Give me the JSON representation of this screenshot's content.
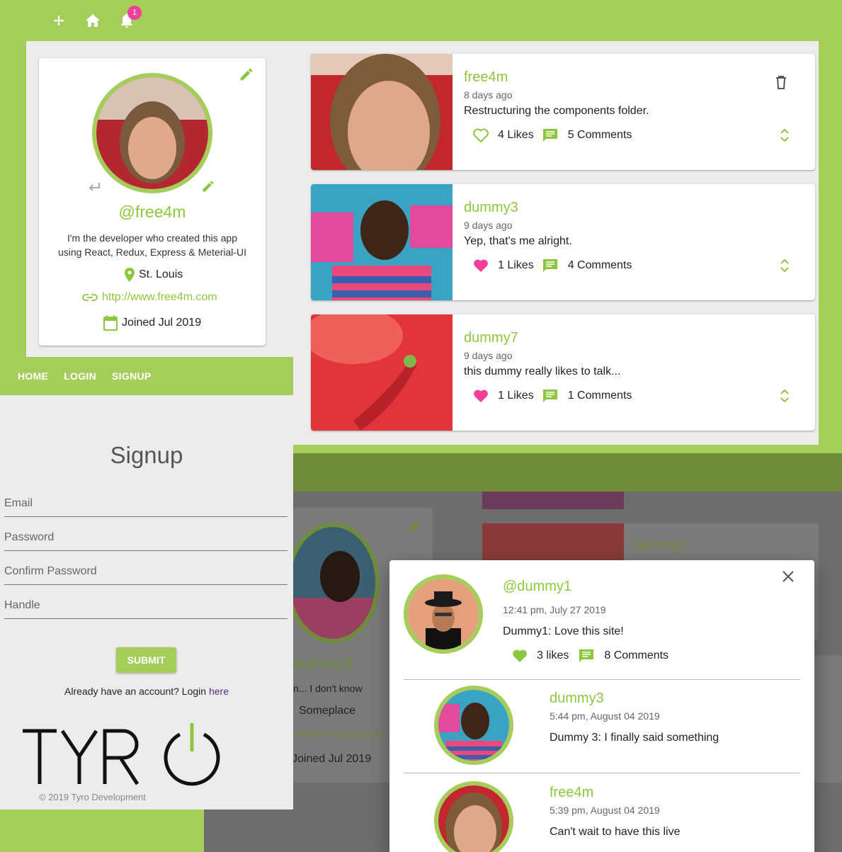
{
  "topbar": {
    "icons": [
      "add-icon",
      "home-icon",
      "notifications-icon"
    ],
    "notification_count": "1"
  },
  "profile": {
    "handle": "@free4m",
    "bio": "I'm the developer who created this app using React, Redux, Express & Meterial-UI",
    "location": "St. Louis",
    "website": "http://www.free4m.com",
    "joined": "Joined Jul 2019"
  },
  "posts": [
    {
      "user": "free4m",
      "date": "8 days ago",
      "body": "Restructuring the components folder.",
      "likes": "4 Likes",
      "comments": "5 Comments",
      "liked": false,
      "deletable": true
    },
    {
      "user": "dummy3",
      "date": "9 days ago",
      "body": "Yep, that's me alright.",
      "likes": "1 Likes",
      "comments": "4 Comments",
      "liked": true,
      "deletable": false
    },
    {
      "user": "dummy7",
      "date": "9 days ago",
      "body": "this dummy really likes to talk...",
      "likes": "1 Likes",
      "comments": "1 Comments",
      "liked": true,
      "deletable": false
    }
  ],
  "navbar": {
    "home": "HOME",
    "login": "LOGIN",
    "signup": "SIGNUP"
  },
  "signup": {
    "title": "Signup",
    "fields": [
      "Email",
      "Password",
      "Confirm Password",
      "Handle"
    ],
    "submit": "SUBMIT",
    "already_text": "Already have an account? Login ",
    "already_link": "here"
  },
  "branding": {
    "logo": "TYRO",
    "copyright": "© 2019 Tyro Development"
  },
  "background_profile": {
    "handle": "dummy3",
    "bio": "n... I don't know",
    "location": "Someplace",
    "website": "noneOfYourDamn.b",
    "joined": "Joined Jul 2019",
    "post_user": "dummy7"
  },
  "dialog": {
    "handle": "@dummy1",
    "date": "12:41 pm, July 27 2019",
    "body": "Dummy1: Love this site!",
    "likes": "3 likes",
    "comments": "8 Comments",
    "comments_list": [
      {
        "user": "dummy3",
        "date": "5:44 pm, August 04 2019",
        "body": "Dummy 3: I finally said something"
      },
      {
        "user": "free4m",
        "date": "5:39 pm, August 04 2019",
        "body": "Can't wait to have this live"
      }
    ]
  },
  "colors": {
    "brand": "#a5cd5a",
    "accent": "#f13f9a",
    "text_green": "#8dc63f"
  }
}
